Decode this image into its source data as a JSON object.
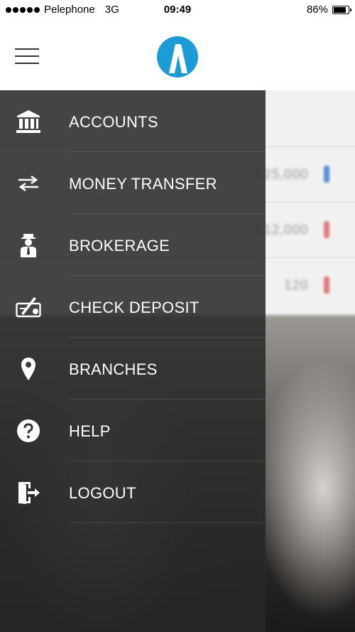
{
  "status_bar": {
    "carrier": "Pelephone",
    "network": "3G",
    "time": "09:49",
    "battery_percent": "86%",
    "battery_level": 0.86
  },
  "header": {
    "logo_icon": "app-logo-icon",
    "menu_icon": "hamburger-icon",
    "accent_color": "#1d9bd7"
  },
  "background_list": {
    "values": [
      "125,000",
      "112,000",
      "120"
    ],
    "arrow_colors": [
      "#5b8dd6",
      "#e07a7a",
      "#e07a7a"
    ]
  },
  "menu": {
    "items": [
      {
        "label": "ACCOUNTS",
        "icon": "bank-icon"
      },
      {
        "label": "MONEY TRANSFER",
        "icon": "transfer-arrows-icon"
      },
      {
        "label": "BROKERAGE",
        "icon": "broker-person-icon"
      },
      {
        "label": "CHECK DEPOSIT",
        "icon": "check-deposit-icon"
      },
      {
        "label": "BRANCHES",
        "icon": "location-pin-icon"
      },
      {
        "label": "HELP",
        "icon": "help-icon"
      },
      {
        "label": "LOGOUT",
        "icon": "logout-icon"
      }
    ]
  }
}
